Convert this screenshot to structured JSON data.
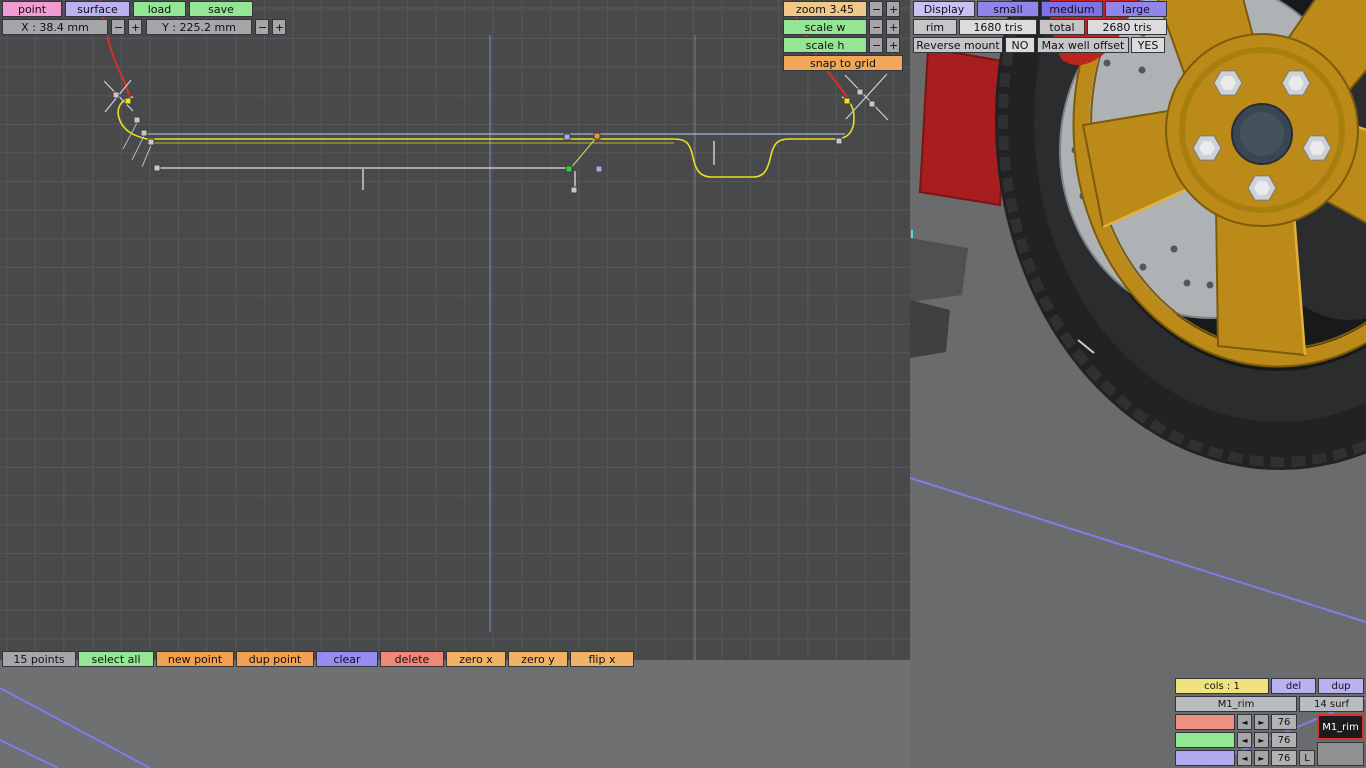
{
  "topbar": {
    "point": "point",
    "surface": "surface",
    "load": "load",
    "save": "save",
    "x_readout": "X : 38.4 mm",
    "y_readout": "Y : 225.2 mm"
  },
  "view_controls": {
    "zoom": "zoom 3.45",
    "scale_w": "scale w",
    "scale_h": "scale h",
    "snap": "snap to grid"
  },
  "display_panel": {
    "display_label": "Display",
    "small": "small",
    "medium": "medium",
    "large": "large",
    "rim_label": "rim",
    "rim_tris": "1680 tris",
    "total_label": "total",
    "total_tris": "2680 tris",
    "reverse_mount_label": "Reverse mount",
    "reverse_mount_value": "NO",
    "max_well_label": "Max well offset",
    "max_well_value": "YES"
  },
  "points_toolbar": {
    "count": "15 points",
    "select_all": "select all",
    "new_point": "new point",
    "dup_point": "dup point",
    "clear": "clear",
    "delete": "delete",
    "zero_x": "zero x",
    "zero_y": "zero y",
    "flip_x": "flip x"
  },
  "surface_panel": {
    "cols": "cols : 1",
    "del": "del",
    "dup": "dup",
    "name": "M1_rim",
    "surf_count": "14 surf",
    "selected_name": "M1_rim",
    "l_button": "L",
    "rows": [
      {
        "value": "76"
      },
      {
        "value": "76"
      },
      {
        "value": "76"
      }
    ]
  },
  "symbols": {
    "minus": "−",
    "plus": "+",
    "arrow_left": "◄",
    "arrow_right": "►"
  },
  "colors": {
    "button_green": "#94e594",
    "button_orange": "#f0a050",
    "button_tan": "#f0b264",
    "button_salmon": "#f08878",
    "button_periwinkle": "#958cf0",
    "button_lavender": "#b9b1f0",
    "button_pink": "#f49ad2",
    "button_yellow": "#f0e27c",
    "button_purple": "#7e70e6",
    "snap_orange": "#f0a858",
    "profile_yellow": "#e8e020",
    "selection_red": "#e03030",
    "rim_gold": "#bc8a18",
    "grid_bg": "#48494b"
  }
}
